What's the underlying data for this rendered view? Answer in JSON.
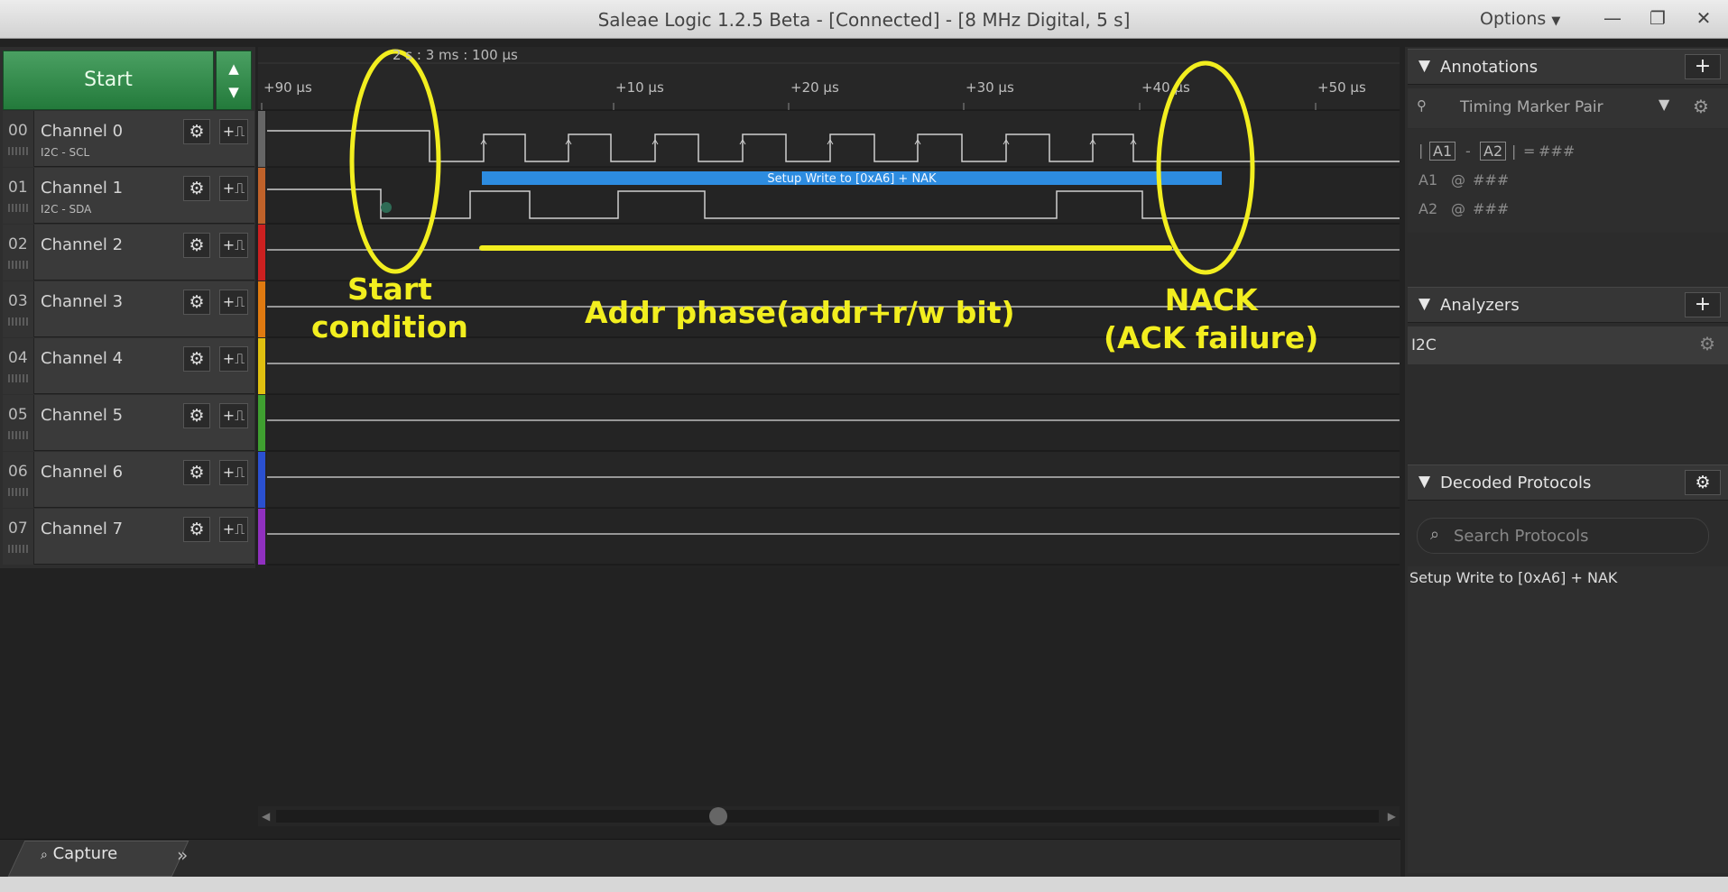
{
  "window": {
    "title": "Saleae Logic 1.2.5 Beta - [Connected] - [8 MHz Digital, 5 s]",
    "options_label": "Options"
  },
  "toolbar": {
    "start_label": "Start"
  },
  "timeline": {
    "center_time": "2 s : 3 ms : 100 µs",
    "ticks": [
      "+90 µs",
      "+10 µs",
      "+20 µs",
      "+30 µs",
      "+40 µs",
      "+50 µs"
    ]
  },
  "channels": [
    {
      "num": "00",
      "name": "Channel 0",
      "sub": "I2C - SCL",
      "color": "#666666"
    },
    {
      "num": "01",
      "name": "Channel 1",
      "sub": "I2C - SDA",
      "color": "#c0622a"
    },
    {
      "num": "02",
      "name": "Channel 2",
      "sub": "",
      "color": "#cc2020"
    },
    {
      "num": "03",
      "name": "Channel 3",
      "sub": "",
      "color": "#e07a10"
    },
    {
      "num": "04",
      "name": "Channel 4",
      "sub": "",
      "color": "#e0c010"
    },
    {
      "num": "05",
      "name": "Channel 5",
      "sub": "",
      "color": "#3fa030"
    },
    {
      "num": "06",
      "name": "Channel 6",
      "sub": "",
      "color": "#2a50d0"
    },
    {
      "num": "07",
      "name": "Channel 7",
      "sub": "",
      "color": "#9030c0"
    }
  ],
  "decoded_bar": {
    "label": "Setup Write to [0xA6] + NAK",
    "color": "#2d8ce0"
  },
  "annotations_overlay": {
    "start": "Start\ncondition",
    "addr": "Addr phase(addr+r/w bit)",
    "nack": "NACK\n(ACK failure)",
    "color": "#f2ee1f"
  },
  "right_panel": {
    "annotations": {
      "title": "Annotations",
      "marker_select": "Timing Marker Pair",
      "a1": "A1",
      "a2": "A2",
      "dash": "-",
      "eq": "=",
      "hash": "###",
      "at": "@"
    },
    "analyzers": {
      "title": "Analyzers",
      "items": [
        "I2C"
      ]
    },
    "decoded": {
      "title": "Decoded Protocols",
      "search_placeholder": "Search Protocols",
      "results": [
        "Setup Write to [0xA6] + NAK"
      ]
    }
  },
  "bottom": {
    "capture_tab": "Capture"
  }
}
